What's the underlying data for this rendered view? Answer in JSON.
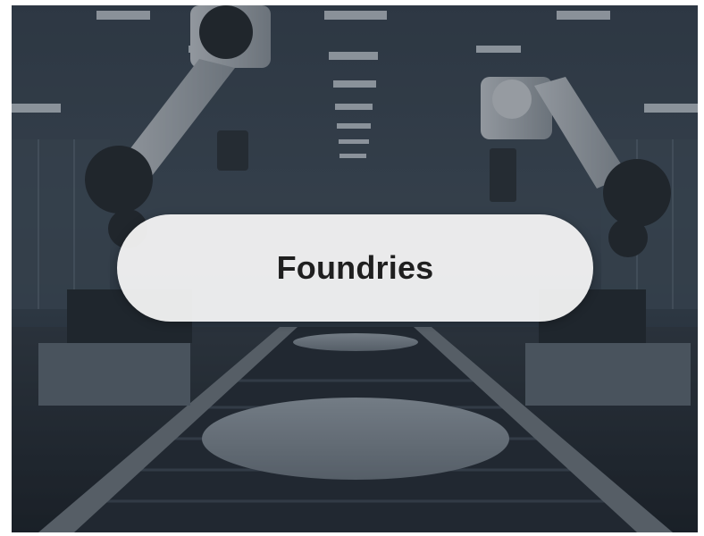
{
  "card": {
    "label": "Foundries"
  },
  "background": {
    "description_icon": "factory-robot-arms-wafer-conveyor-image",
    "colors": {
      "overlay": "#2b3540",
      "pill": "#f5f5f5",
      "label": "#1f1f1f"
    }
  }
}
